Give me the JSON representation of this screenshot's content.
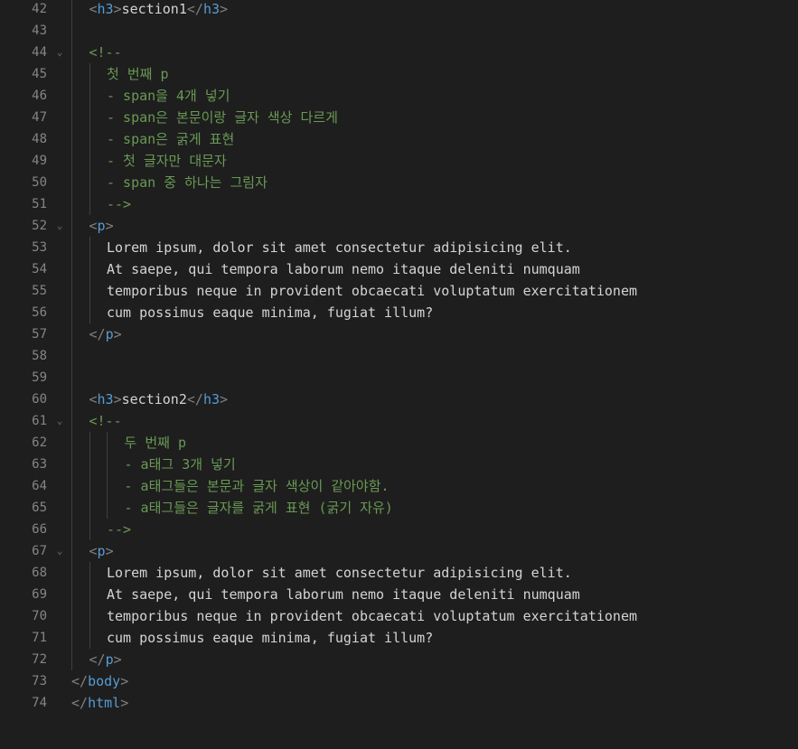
{
  "editor": {
    "lines": [
      {
        "num": "42",
        "fold": "",
        "indent": 1,
        "guides": [
          1
        ],
        "tokens": [
          {
            "t": "br",
            "v": "<"
          },
          {
            "t": "tag",
            "v": "h3"
          },
          {
            "t": "br",
            "v": ">"
          },
          {
            "t": "tx",
            "v": "section1"
          },
          {
            "t": "br",
            "v": "</"
          },
          {
            "t": "tag",
            "v": "h3"
          },
          {
            "t": "br",
            "v": ">"
          }
        ]
      },
      {
        "num": "43",
        "fold": "",
        "indent": 0,
        "guides": [
          1
        ],
        "tokens": []
      },
      {
        "num": "44",
        "fold": "⌄",
        "indent": 1,
        "guides": [
          1
        ],
        "tokens": [
          {
            "t": "cm",
            "v": "<!--"
          }
        ]
      },
      {
        "num": "45",
        "fold": "",
        "indent": 2,
        "guides": [
          1,
          2
        ],
        "tokens": [
          {
            "t": "cm",
            "v": "첫 번째 p"
          }
        ]
      },
      {
        "num": "46",
        "fold": "",
        "indent": 2,
        "guides": [
          1,
          2
        ],
        "tokens": [
          {
            "t": "cm",
            "v": "- span을 4개 넣기"
          }
        ]
      },
      {
        "num": "47",
        "fold": "",
        "indent": 2,
        "guides": [
          1,
          2
        ],
        "tokens": [
          {
            "t": "cm",
            "v": "- span은 본문이랑 글자 색상 다르게"
          }
        ]
      },
      {
        "num": "48",
        "fold": "",
        "indent": 2,
        "guides": [
          1,
          2
        ],
        "tokens": [
          {
            "t": "cm",
            "v": "- span은 굵게 표현"
          }
        ]
      },
      {
        "num": "49",
        "fold": "",
        "indent": 2,
        "guides": [
          1,
          2
        ],
        "tokens": [
          {
            "t": "cm",
            "v": "- 첫 글자만 대문자"
          }
        ]
      },
      {
        "num": "50",
        "fold": "",
        "indent": 2,
        "guides": [
          1,
          2
        ],
        "tokens": [
          {
            "t": "cm",
            "v": "- span 중 하나는 그림자"
          }
        ]
      },
      {
        "num": "51",
        "fold": "",
        "indent": 2,
        "guides": [
          1,
          2
        ],
        "tokens": [
          {
            "t": "cm",
            "v": "-->"
          }
        ]
      },
      {
        "num": "52",
        "fold": "⌄",
        "indent": 1,
        "guides": [
          1
        ],
        "tokens": [
          {
            "t": "br",
            "v": "<"
          },
          {
            "t": "tag",
            "v": "p"
          },
          {
            "t": "br",
            "v": ">"
          }
        ]
      },
      {
        "num": "53",
        "fold": "",
        "indent": 2,
        "guides": [
          1,
          2
        ],
        "tokens": [
          {
            "t": "tx",
            "v": "Lorem ipsum, dolor sit amet consectetur adipisicing elit."
          }
        ]
      },
      {
        "num": "54",
        "fold": "",
        "indent": 2,
        "guides": [
          1,
          2
        ],
        "tokens": [
          {
            "t": "tx",
            "v": "At saepe, qui tempora laborum nemo itaque deleniti numquam"
          }
        ]
      },
      {
        "num": "55",
        "fold": "",
        "indent": 2,
        "guides": [
          1,
          2
        ],
        "tokens": [
          {
            "t": "tx",
            "v": "temporibus neque in provident obcaecati voluptatum exercitationem"
          }
        ]
      },
      {
        "num": "56",
        "fold": "",
        "indent": 2,
        "guides": [
          1,
          2
        ],
        "tokens": [
          {
            "t": "tx",
            "v": "cum possimus eaque minima, fugiat illum?"
          }
        ]
      },
      {
        "num": "57",
        "fold": "",
        "indent": 1,
        "guides": [
          1
        ],
        "tokens": [
          {
            "t": "br",
            "v": "</"
          },
          {
            "t": "tag",
            "v": "p"
          },
          {
            "t": "br",
            "v": ">"
          }
        ]
      },
      {
        "num": "58",
        "fold": "",
        "indent": 0,
        "guides": [
          1
        ],
        "tokens": []
      },
      {
        "num": "59",
        "fold": "",
        "indent": 0,
        "guides": [
          1
        ],
        "tokens": []
      },
      {
        "num": "60",
        "fold": "",
        "indent": 1,
        "guides": [
          1
        ],
        "tokens": [
          {
            "t": "br",
            "v": "<"
          },
          {
            "t": "tag",
            "v": "h3"
          },
          {
            "t": "br",
            "v": ">"
          },
          {
            "t": "tx",
            "v": "section2"
          },
          {
            "t": "br",
            "v": "</"
          },
          {
            "t": "tag",
            "v": "h3"
          },
          {
            "t": "br",
            "v": ">"
          }
        ]
      },
      {
        "num": "61",
        "fold": "⌄",
        "indent": 1,
        "guides": [
          1
        ],
        "tokens": [
          {
            "t": "cm",
            "v": "<!--"
          }
        ]
      },
      {
        "num": "62",
        "fold": "",
        "indent": 3,
        "guides": [
          1,
          2,
          3
        ],
        "tokens": [
          {
            "t": "cm",
            "v": "두 번째 p"
          }
        ]
      },
      {
        "num": "63",
        "fold": "",
        "indent": 3,
        "guides": [
          1,
          2,
          3
        ],
        "tokens": [
          {
            "t": "cm",
            "v": "- a태그 3개 넣기"
          }
        ]
      },
      {
        "num": "64",
        "fold": "",
        "indent": 3,
        "guides": [
          1,
          2,
          3
        ],
        "tokens": [
          {
            "t": "cm",
            "v": "- a태그들은 본문과 글자 색상이 같아야함."
          }
        ]
      },
      {
        "num": "65",
        "fold": "",
        "indent": 3,
        "guides": [
          1,
          2,
          3
        ],
        "tokens": [
          {
            "t": "cm",
            "v": "- a태그들은 글자를 굵게 표현 (굵기 자유)"
          }
        ]
      },
      {
        "num": "66",
        "fold": "",
        "indent": 2,
        "guides": [
          1,
          2
        ],
        "tokens": [
          {
            "t": "cm",
            "v": "-->"
          }
        ]
      },
      {
        "num": "67",
        "fold": "⌄",
        "indent": 1,
        "guides": [
          1
        ],
        "tokens": [
          {
            "t": "br",
            "v": "<"
          },
          {
            "t": "tag",
            "v": "p"
          },
          {
            "t": "br",
            "v": ">"
          }
        ]
      },
      {
        "num": "68",
        "fold": "",
        "indent": 2,
        "guides": [
          1,
          2
        ],
        "tokens": [
          {
            "t": "tx",
            "v": "Lorem ipsum, dolor sit amet consectetur adipisicing elit."
          }
        ]
      },
      {
        "num": "69",
        "fold": "",
        "indent": 2,
        "guides": [
          1,
          2
        ],
        "tokens": [
          {
            "t": "tx",
            "v": "At saepe, qui tempora laborum nemo itaque deleniti numquam"
          }
        ]
      },
      {
        "num": "70",
        "fold": "",
        "indent": 2,
        "guides": [
          1,
          2
        ],
        "tokens": [
          {
            "t": "tx",
            "v": "temporibus neque in provident obcaecati voluptatum exercitationem"
          }
        ]
      },
      {
        "num": "71",
        "fold": "",
        "indent": 2,
        "guides": [
          1,
          2
        ],
        "tokens": [
          {
            "t": "tx",
            "v": "cum possimus eaque minima, fugiat illum?"
          }
        ]
      },
      {
        "num": "72",
        "fold": "",
        "indent": 1,
        "guides": [
          1
        ],
        "tokens": [
          {
            "t": "br",
            "v": "</"
          },
          {
            "t": "tag",
            "v": "p"
          },
          {
            "t": "br",
            "v": ">"
          }
        ]
      },
      {
        "num": "73",
        "fold": "",
        "indent": 0,
        "guides": [],
        "tokens": [
          {
            "t": "br",
            "v": "</"
          },
          {
            "t": "tag",
            "v": "body"
          },
          {
            "t": "br",
            "v": ">"
          }
        ]
      },
      {
        "num": "74",
        "fold": "",
        "indent": 0,
        "guides": [],
        "tokens": [
          {
            "t": "br",
            "v": "</"
          },
          {
            "t": "tag",
            "v": "html"
          },
          {
            "t": "br",
            "v": ">"
          }
        ]
      }
    ],
    "colors": {
      "background": "#1e1e1e",
      "line_number": "#858585",
      "tag": "#569cd6",
      "bracket": "#808080",
      "comment": "#6a9955",
      "text": "#d4d4d4"
    }
  }
}
